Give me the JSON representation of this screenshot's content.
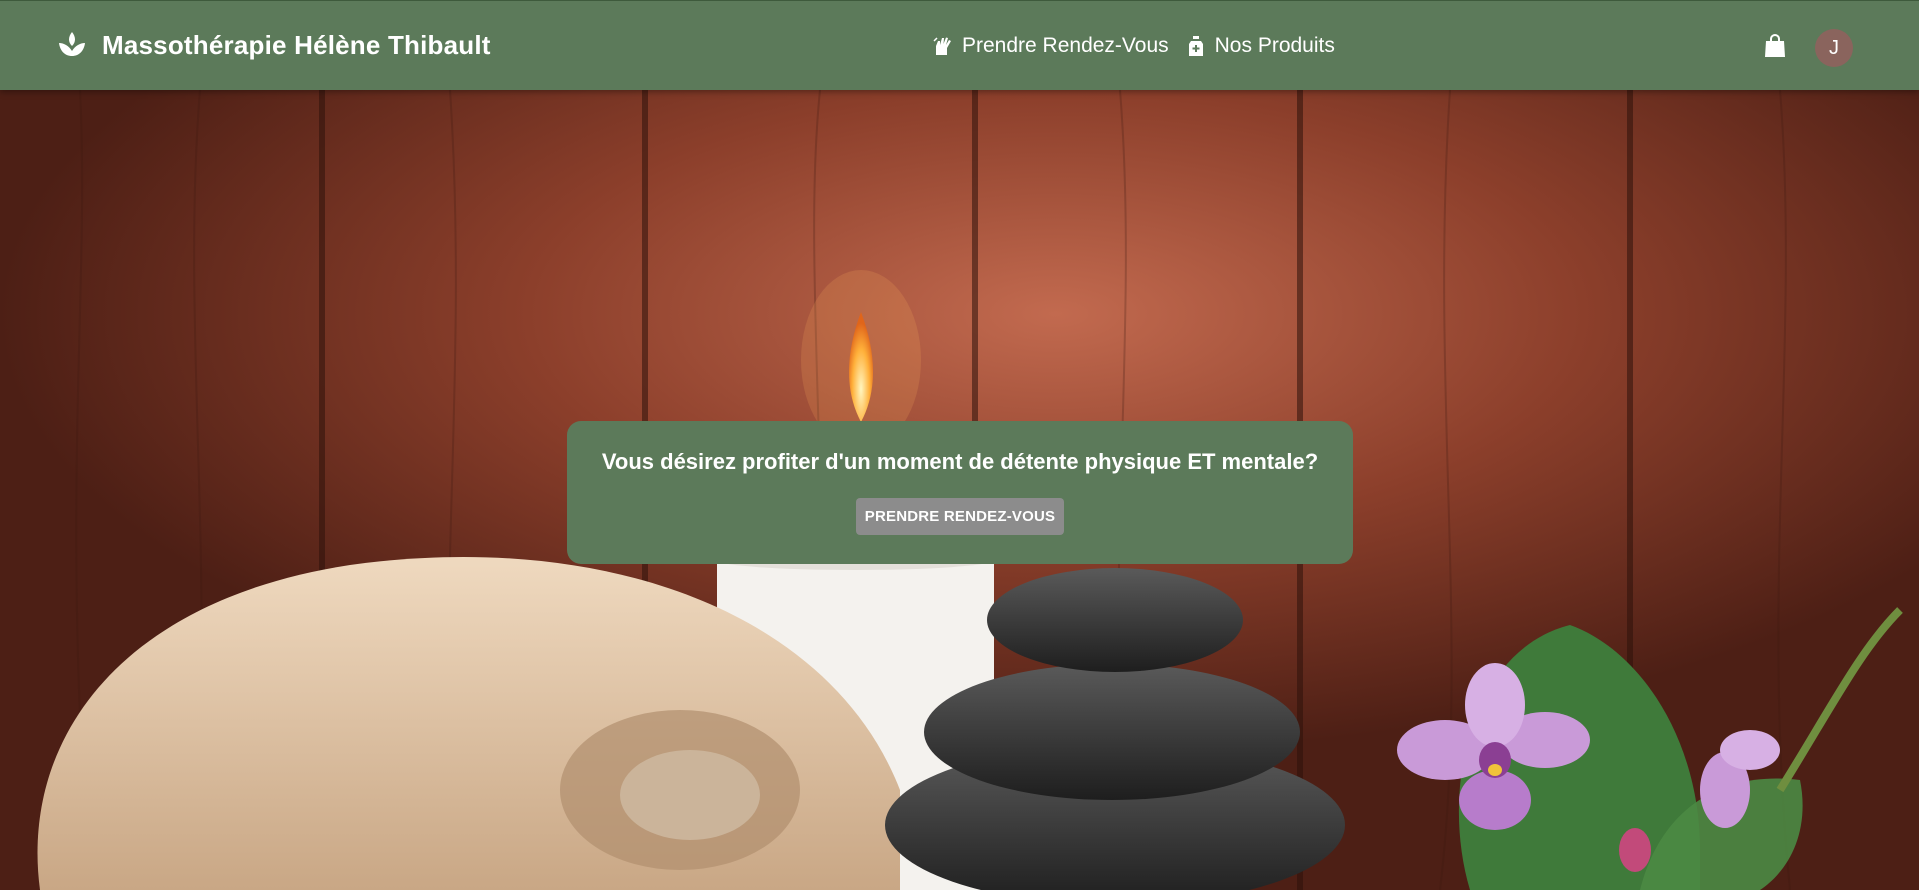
{
  "header": {
    "brand_name": "Massothérapie Hélène Thibault",
    "brand_icon": "lotus-icon",
    "background_color": "#5c7a5a",
    "nav": [
      {
        "label": "Prendre Rendez-Vous",
        "icon": "hand-massage-icon"
      },
      {
        "label": "Nos Produits",
        "icon": "bottle-plus-icon"
      }
    ],
    "cart_icon": "shopping-bag-icon",
    "user_avatar_initial": "J",
    "avatar_color": "#8a645d"
  },
  "hero": {
    "background_image": "spa-scene-candle-stones-towel-orchid",
    "question": "Vous désirez profiter d'un moment de détente physique ET mentale?",
    "cta_label": "PRENDRE RENDEZ-VOUS",
    "card_color": "#5c7a5a",
    "button_color": "#8c8c8c"
  }
}
